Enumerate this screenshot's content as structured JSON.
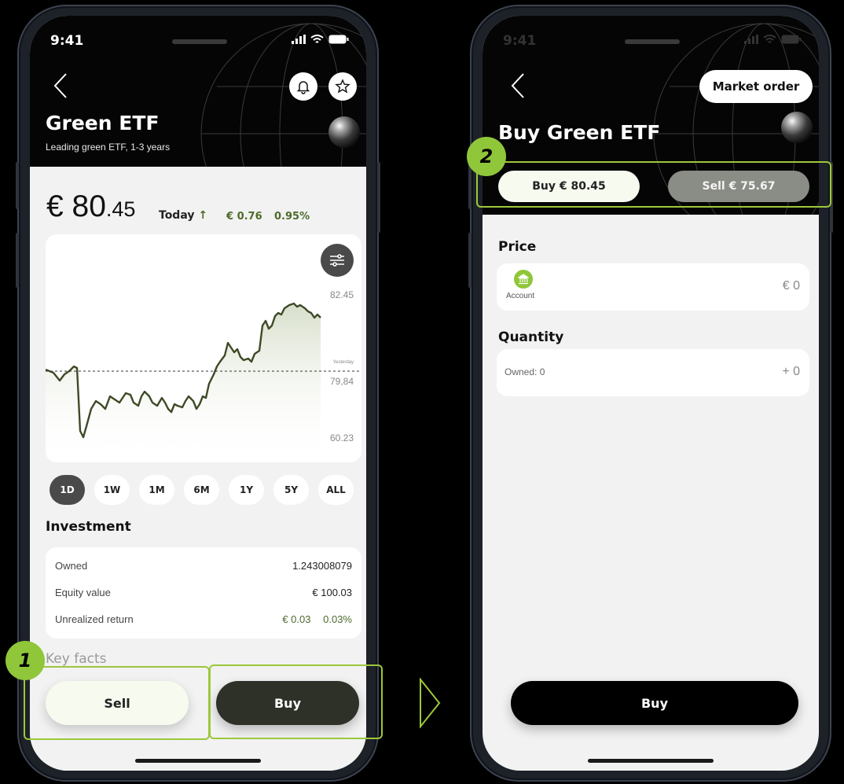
{
  "phone1": {
    "status_time": "9:41",
    "title": "Green ETF",
    "subtitle": "Leading green ETF, 1-3 years",
    "price_int": "€ 80",
    "price_dec": ".45",
    "today_label": "Today",
    "change_abs": "€ 0.76",
    "change_pct": "0.95%",
    "chart": {
      "y_high": "82.45",
      "y_mid": "79,84",
      "y_low": "60.23",
      "ref_label": "Yesterday"
    },
    "ranges": [
      "1D",
      "1W",
      "1M",
      "6M",
      "1Y",
      "5Y",
      "ALL"
    ],
    "active_range": "1D",
    "investment_title": "Investment",
    "investment": {
      "owned_label": "Owned",
      "owned_value": "1.243008079",
      "equity_label": "Equity value",
      "equity_value": "€ 100.03",
      "return_label": "Unrealized return",
      "return_abs": "€ 0.03",
      "return_pct": "0.03%"
    },
    "key_facts": "Key facts",
    "sell_label": "Sell",
    "buy_label": "Buy",
    "badge": "1"
  },
  "phone2": {
    "status_time": "9:41",
    "market_order": "Market order",
    "title": "Buy Green ETF",
    "buy_tab": "Buy € 80.45",
    "sell_tab": "Sell € 75.67",
    "price_title": "Price",
    "account_label": "Account",
    "price_value": "€ 0",
    "quantity_title": "Quantity",
    "owned_label": "Owned: 0",
    "quantity_value": "+ 0",
    "buy_label": "Buy",
    "badge": "2"
  },
  "colors": {
    "accent_green": "#8fc63a",
    "positive": "#4d6b2b",
    "dark_button": "#2e3128"
  },
  "icons": [
    "back-chevron-icon",
    "bell-icon",
    "star-icon",
    "filter-sliders-icon",
    "bank-icon",
    "signal-icon",
    "wifi-icon",
    "battery-icon",
    "next-arrow-icon"
  ]
}
